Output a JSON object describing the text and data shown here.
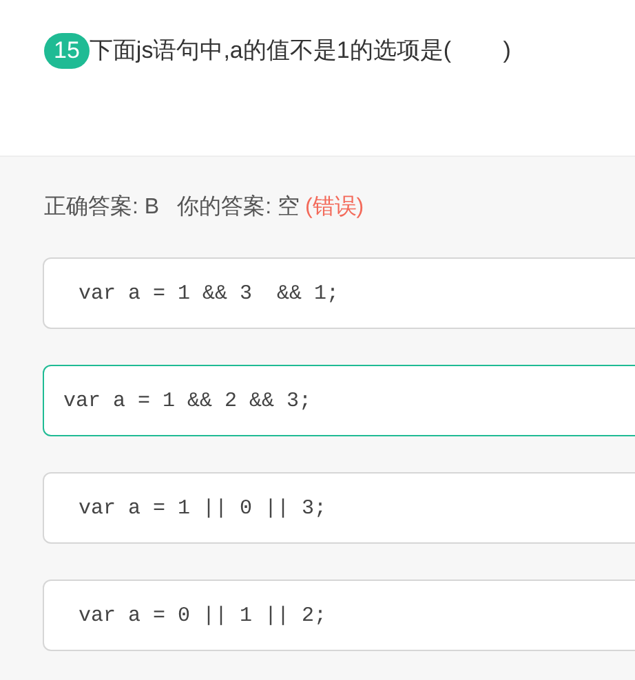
{
  "question": {
    "number": "15",
    "text": "下面js语句中,a的值不是1的选项是(        )"
  },
  "result": {
    "correct_label": "正确答案: B",
    "your_label": "你的答案: 空",
    "verdict": "(错误)"
  },
  "options": [
    {
      "code": " var a = 1 && 3  && 1;",
      "correct": false
    },
    {
      "code": "var a = 1 && 2 && 3;",
      "correct": true
    },
    {
      "code": " var a = 1 || 0 || 3;",
      "correct": false
    },
    {
      "code": " var a = 0 || 1 || 2;",
      "correct": false
    }
  ]
}
